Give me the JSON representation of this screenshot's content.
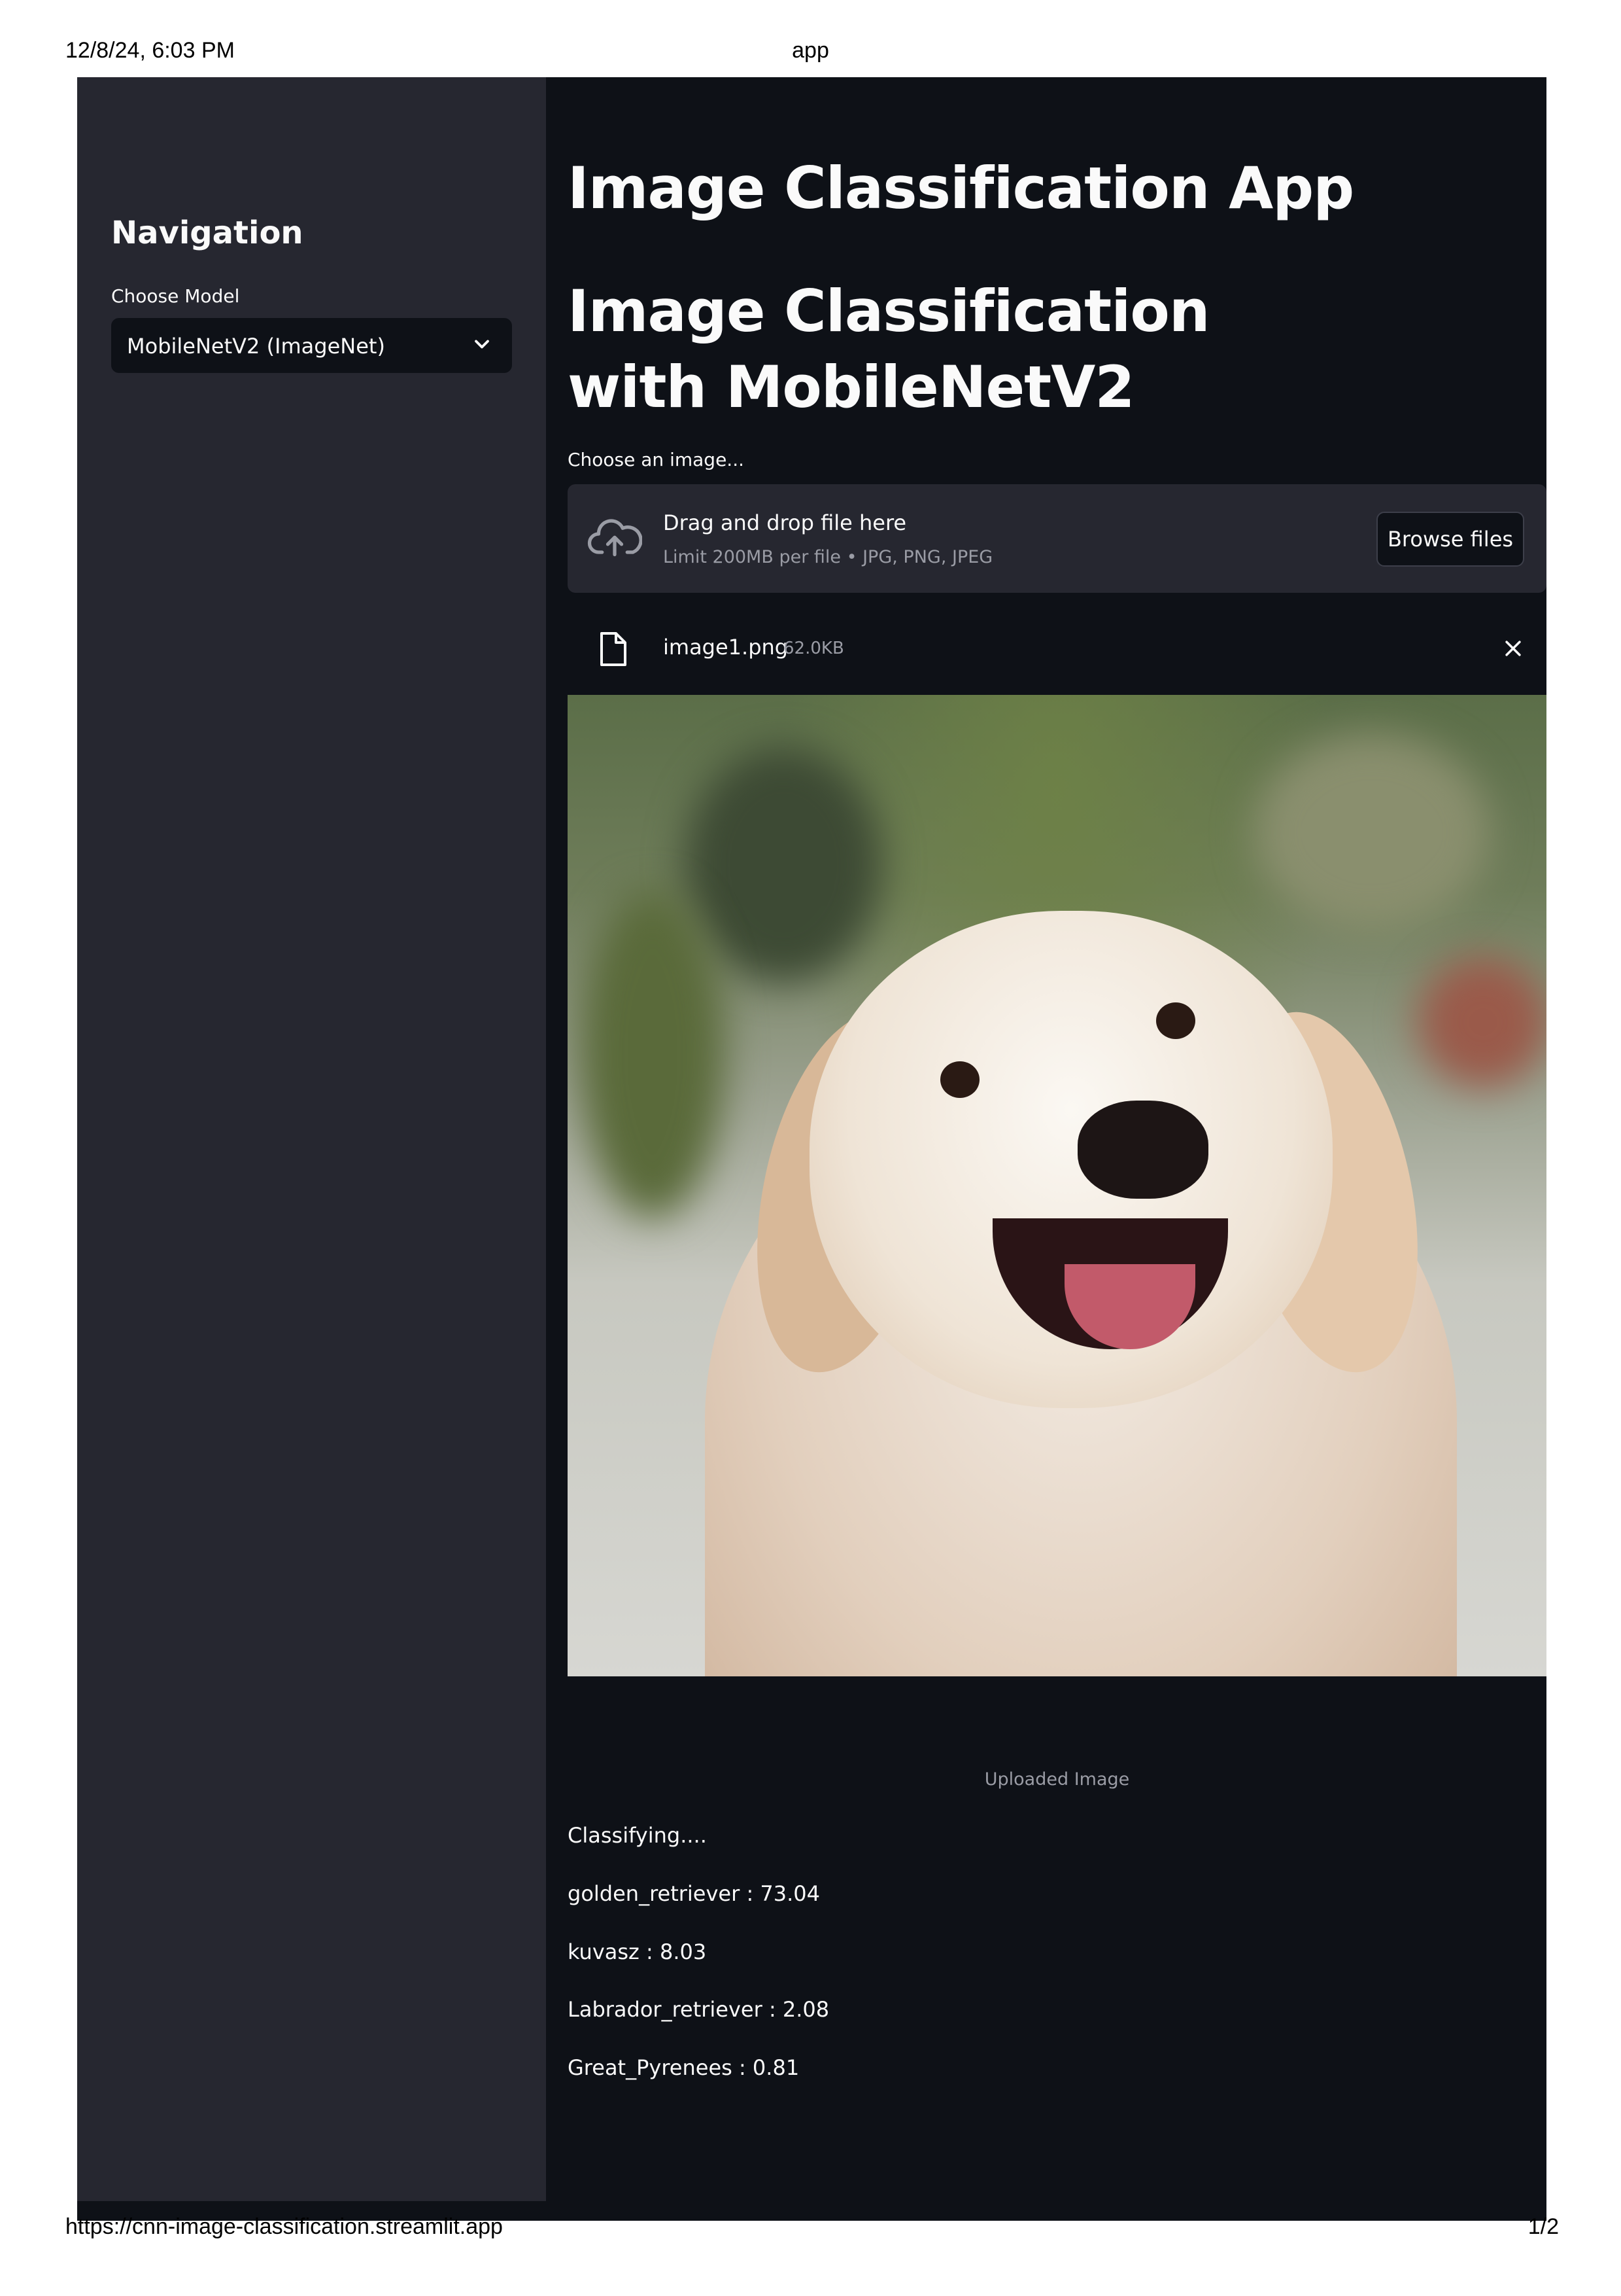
{
  "print_header": {
    "datetime": "12/8/24, 6:03 PM",
    "title": "app"
  },
  "print_footer": {
    "url": "https://cnn-image-classification.streamlit.app",
    "page": "1/2"
  },
  "sidebar": {
    "title": "Navigation",
    "model_select": {
      "label": "Choose Model",
      "value": "MobileNetV2 (ImageNet)"
    }
  },
  "main": {
    "title": "Image Classification App",
    "subtitle": "Image Classification with MobileNetV2",
    "uploader": {
      "label": "Choose an image...",
      "drop_text": "Drag and drop file here",
      "limit_text": "Limit 200MB per file • JPG, PNG, JPEG",
      "browse_label": "Browse files"
    },
    "uploaded_file": {
      "name": "image1.png",
      "size": "62.0KB"
    },
    "image_caption": "Uploaded Image",
    "status": "Classifying....",
    "predictions": [
      "golden_retriever : 73.04",
      "kuvasz : 8.03",
      "Labrador_retriever : 2.08",
      "Great_Pyrenees : 0.81"
    ]
  },
  "icons": {
    "upload": "cloud-upload-icon",
    "file": "file-icon",
    "close": "close-icon",
    "dropdown": "chevron-down-icon"
  },
  "colors": {
    "background": "#0e1117",
    "sidebar": "#262730",
    "text": "#fafafa",
    "muted": "#9a9ca5"
  }
}
